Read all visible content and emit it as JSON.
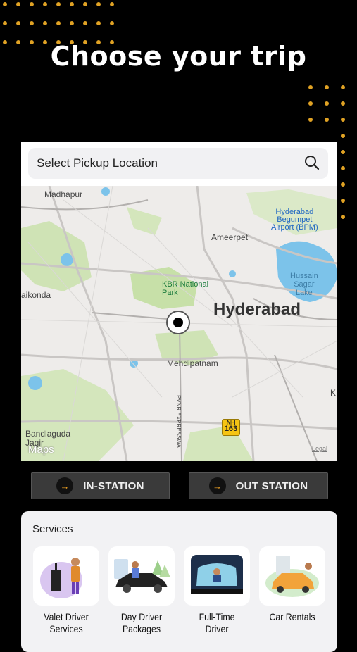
{
  "hero": {
    "title": "Choose your trip"
  },
  "search": {
    "placeholder": "Select Pickup Location",
    "icon": "search-icon"
  },
  "map": {
    "labels": {
      "madhapur": "Madhapur",
      "airport": "Hyderabad\nBegumpet\nAirport (BPM)",
      "ameerpet": "Ameerpet",
      "hussain": "Hussain\nSagar\nLake",
      "kondapur": "aikonda",
      "kbr": "KBR National\nPark",
      "hyderabad": "Hyderabad",
      "mehdipatnam": "Mehdipatnam",
      "expressway": "PVNR EXPRESSWA",
      "bandlaguda": "Bandlaguda\nJagir",
      "k": "K"
    },
    "highway": {
      "prefix": "NH",
      "number": "163"
    },
    "attribution": "Maps",
    "legal": "Legal"
  },
  "trip_buttons": {
    "instation": "IN-STATION",
    "outstation": "OUT STATION"
  },
  "services": {
    "title": "Services",
    "items": [
      {
        "label": "Valet Driver Services"
      },
      {
        "label": "Day Driver Packages"
      },
      {
        "label": "Full-Time Driver"
      },
      {
        "label": "Car Rentals"
      }
    ]
  },
  "colors": {
    "accent": "#e0a224",
    "background": "#000000"
  }
}
